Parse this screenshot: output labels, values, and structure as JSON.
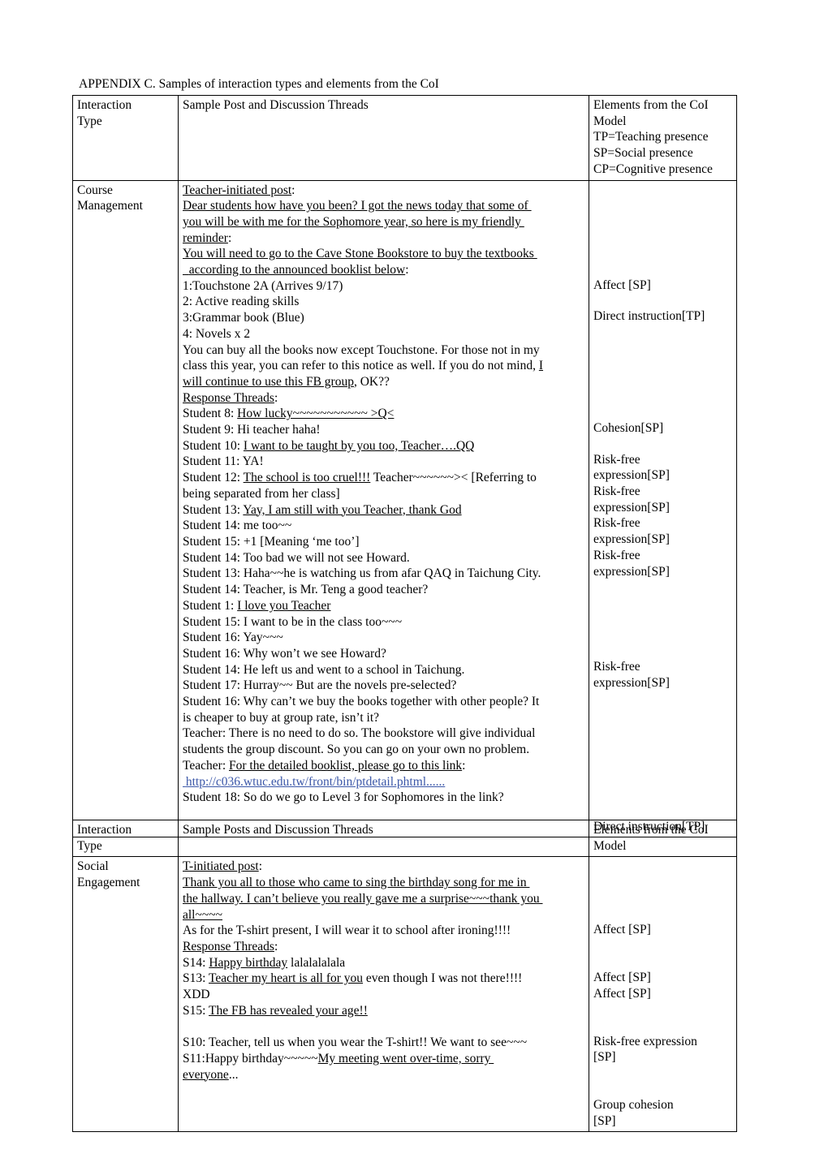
{
  "document": {
    "caption": "APPENDIX C. Samples of interaction types and elements from the CoI"
  },
  "table_one": {
    "header": {
      "col1": "Interaction\nType",
      "col2": "Sample Post and Discussion Threads",
      "col3_lines": [
        "Elements from the CoI",
        "Model",
        "TP=Teaching presence",
        "SP=Social presence",
        "CP=Cognitive presence"
      ]
    },
    "row": {
      "interaction_type": "Course\nManagement",
      "body_lines": [
        {
          "text": "Teacher-initiated post",
          "style": "underline",
          "tail": ":"
        },
        {
          "text": "Dear students how have you been? I got the news today that some of ",
          "style": "underline"
        },
        {
          "text": "you will be with me for the Sophomore year, so here is my friendly ",
          "style": "underline"
        },
        {
          "text": "reminder",
          "style": "underline",
          "tail": ":"
        },
        {
          "text": "You will need to go to the Cave Stone Bookstore to buy the textbooks ",
          "style": "underline"
        },
        {
          "text": "  according to the announced booklist below",
          "style": "underline",
          "tail": ":"
        },
        {
          "text": "1:Touchstone 2A (Arrives 9/17)",
          "style": "plain"
        },
        {
          "text": "2: Active reading skills",
          "style": "plain"
        },
        {
          "text": "3:Grammar book (Blue)",
          "style": "plain"
        },
        {
          "text": "4: Novels x 2",
          "style": "plain"
        },
        {
          "text": "You can buy all the books now except Touchstone. For those not in my ",
          "style": "plain"
        },
        {
          "text": "class this year, you can refer to this notice as well. If you do not mind, ",
          "style": "plain",
          "tail_u": "I"
        },
        {
          "text": "will continue to use this FB group",
          "style": "underline",
          "tail": ", OK??"
        },
        {
          "text": "Response Threads",
          "style": "underline",
          "tail": ":"
        },
        {
          "prefix": "Student 8: ",
          "text": "How lucky~~~~~~~~~~~ >Q<",
          "style": "underline"
        },
        {
          "text": "Student 9: Hi teacher haha!",
          "style": "plain"
        },
        {
          "prefix": "Student 10: ",
          "text": "I want to be taught by you too, Teacher….QQ",
          "style": "underline"
        },
        {
          "text": "Student 11: YA!",
          "style": "plain"
        },
        {
          "prefix": "Student 12: ",
          "text": "The school is too cruel!!!",
          "style": "underline",
          "tail": " Teacher~~~~~~>< [Referring to"
        },
        {
          "text": "being separated from her class]",
          "style": "plain"
        },
        {
          "prefix": "Student 13: ",
          "text": "Yay, I am still with you Teacher, thank God",
          "style": "underline"
        },
        {
          "text": "Student 14: me too~~",
          "style": "plain"
        },
        {
          "text": "Student 15: +1 [Meaning ‘me too’]",
          "style": "plain"
        },
        {
          "text": "Student 14: Too bad we will not see Howard.",
          "style": "plain"
        },
        {
          "text": "Student 13: Haha~~he is watching us from afar QAQ in Taichung City.",
          "style": "plain"
        },
        {
          "text": "Student 14: Teacher, is Mr. Teng a good teacher?",
          "style": "plain"
        },
        {
          "prefix": "Student 1: ",
          "text": "I love you Teacher",
          "style": "underline"
        },
        {
          "text": "Student 15: I want to be in the class too~~~",
          "style": "plain"
        },
        {
          "text": "Student 16: Yay~~~",
          "style": "plain"
        },
        {
          "text": "Student 16: Why won’t we see Howard?",
          "style": "plain"
        },
        {
          "text": "Student 14: He left us and went to a school in Taichung.",
          "style": "plain"
        },
        {
          "text": "Student 17: Hurray~~ But are the novels pre-selected?",
          "style": "plain"
        },
        {
          "text": "Student 16: Why can’t we buy the books together with other people? It ",
          "style": "plain"
        },
        {
          "text": "is cheaper to buy at group rate, isn’t it?",
          "style": "plain"
        },
        {
          "text": "Teacher: There is no need to do so. The bookstore will give individual ",
          "style": "plain"
        },
        {
          "text": "students the group discount. So you can go on your own no problem.",
          "style": "plain"
        },
        {
          "prefix": "Teacher: ",
          "text": "For the detailed booklist, please go to this link",
          "style": "underline",
          "tail": ":"
        },
        {
          "text": " http://c036.wtuc.edu.tw/front/bin/ptdetail.phtml......",
          "style": "link"
        },
        {
          "text": "Student 18: So do we go to Level 3 for Sophomores in the link?",
          "style": "plain"
        }
      ],
      "elements": [
        {
          "text": "Affect [SP]",
          "offset_class": "off-1"
        },
        {
          "text": "Direct instruction[TP]",
          "offset_class": "off-2"
        },
        {
          "text": "Cohesion[SP]",
          "offset_class": "off-3"
        },
        {
          "text": "Risk-free\nexpression[SP]",
          "offset_class": "off-4"
        },
        {
          "text": "Risk-free\nexpression[SP]",
          "offset_class": ""
        },
        {
          "text": "Risk-free\nexpression[SP]",
          "offset_class": ""
        },
        {
          "text": "Risk-free\nexpression[SP]",
          "offset_class": ""
        },
        {
          "text": "Risk-free\nexpression[SP]",
          "offset_class": "off-5"
        },
        {
          "text": "Direct instruction[TP]",
          "offset_class": "off-6"
        }
      ]
    }
  },
  "table_two": {
    "header": {
      "col1": "Interaction\nType",
      "col2": "Sample Posts and Discussion Threads",
      "col3_lines": [
        "Elements from the CoI",
        "Model"
      ]
    },
    "row": {
      "interaction_type": "Social\nEngagement",
      "body_lines": [
        {
          "text": "T-initiated post",
          "style": "underline",
          "tail": ":"
        },
        {
          "text": "Thank you all to those who came to sing the birthday song for me in ",
          "style": "underline"
        },
        {
          "text": "the hallway. I can’t believe you really gave me a surprise~~~thank you ",
          "style": "underline"
        },
        {
          "text": "all~~~~",
          "style": "underline"
        },
        {
          "text": "As for the T-shirt present, I will wear it to school after ironing!!!!",
          "style": "plain"
        },
        {
          "text": "Response Threads",
          "style": "underline",
          "tail": ":"
        },
        {
          "prefix": "S14: ",
          "text": "Happy birthday",
          "style": "underline",
          "tail": " lalalalalala"
        },
        {
          "prefix": "S13: ",
          "text": "Teacher my heart is all for you",
          "style": "underline",
          "tail": " even though I was not there!!!!"
        },
        {
          "text": "XDD",
          "style": "plain"
        },
        {
          "prefix": "S15: ",
          "text": "The FB has revealed your age!!",
          "style": "underline"
        },
        {
          "text": "",
          "style": "plain"
        },
        {
          "text": "S10: Teacher, tell us when you wear the T-shirt!! We want to see~~~",
          "style": "plain"
        },
        {
          "prefix": "S11:Happy birthday~~~~~",
          "text": "My meeting went over-time, sorry ",
          "style": "underline"
        },
        {
          "text": "everyone",
          "style": "underline",
          "tail": "..."
        }
      ],
      "elements": [
        {
          "text": "Affect [SP]",
          "offset_class": "t2-off-1"
        },
        {
          "text": "Affect [SP]",
          "offset_class": "t2-off-2"
        },
        {
          "text": "Affect [SP]",
          "offset_class": "t2-off-3"
        },
        {
          "text": "Risk-free expression\n[SP]",
          "offset_class": "t2-off-4"
        },
        {
          "text": "Group cohesion\n[SP]",
          "offset_class": "t2-off-5"
        }
      ]
    }
  }
}
